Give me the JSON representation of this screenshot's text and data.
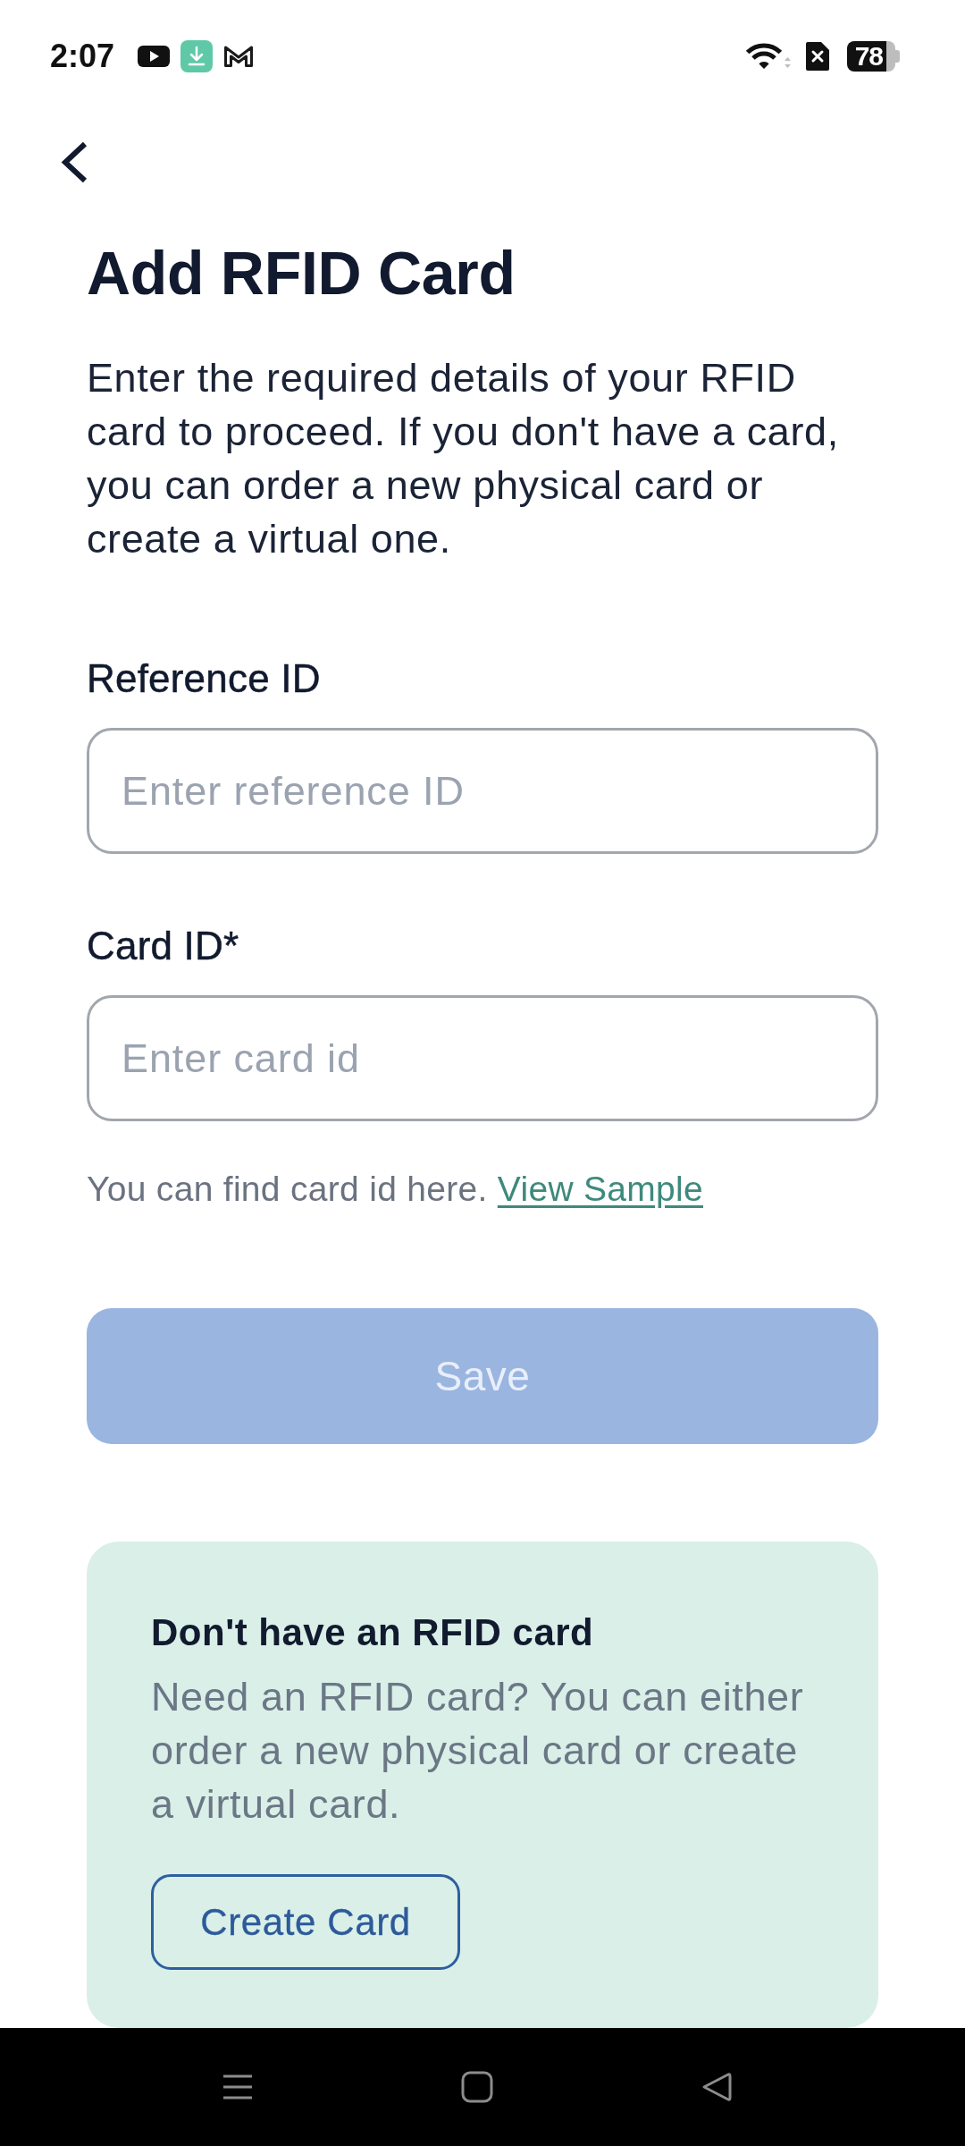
{
  "status_bar": {
    "time": "2:07",
    "battery": "78"
  },
  "header": {
    "title": "Add RFID Card",
    "description": "Enter the required details of your RFID card to proceed. If you don't have a card, you can order a new physical card or create a virtual one."
  },
  "fields": [
    {
      "label": "Reference ID",
      "placeholder": "Enter reference ID"
    },
    {
      "label": "Card ID*",
      "placeholder": "Enter card id"
    }
  ],
  "hint": {
    "text": "You can find card id here.",
    "link": "View Sample"
  },
  "save_button": {
    "label": "Save",
    "disabled": true
  },
  "promo_card": {
    "title": "Don't have an RFID card",
    "text": "Need an RFID card? You can either order a new physical card or create a virtual card.",
    "button": "Create Card"
  }
}
